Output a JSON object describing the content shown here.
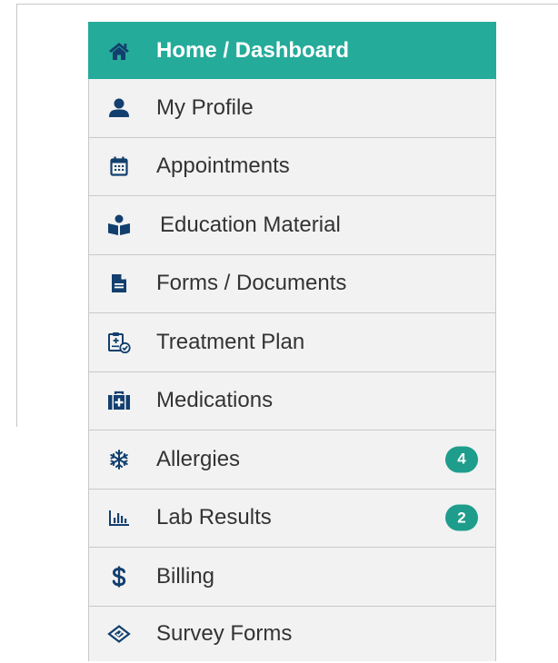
{
  "nav": {
    "items": [
      {
        "id": "home",
        "label": "Home / Dashboard",
        "icon": "home-icon",
        "active": true,
        "badge": null
      },
      {
        "id": "profile",
        "label": "My Profile",
        "icon": "user-icon",
        "active": false,
        "badge": null
      },
      {
        "id": "appointments",
        "label": "Appointments",
        "icon": "calendar-icon",
        "active": false,
        "badge": null
      },
      {
        "id": "education",
        "label": "Education Material",
        "icon": "book-reader-icon",
        "active": false,
        "badge": null
      },
      {
        "id": "forms",
        "label": "Forms / Documents",
        "icon": "document-icon",
        "active": false,
        "badge": null
      },
      {
        "id": "treatment",
        "label": "Treatment Plan",
        "icon": "clipboard-check-icon",
        "active": false,
        "badge": null
      },
      {
        "id": "medications",
        "label": "Medications",
        "icon": "medkit-icon",
        "active": false,
        "badge": null
      },
      {
        "id": "allergies",
        "label": "Allergies",
        "icon": "snowflake-icon",
        "active": false,
        "badge": "4"
      },
      {
        "id": "lab",
        "label": "Lab Results",
        "icon": "bar-chart-icon",
        "active": false,
        "badge": "2"
      },
      {
        "id": "billing",
        "label": "Billing",
        "icon": "dollar-icon",
        "active": false,
        "badge": null
      },
      {
        "id": "survey",
        "label": "Survey Forms",
        "icon": "diamond-icon",
        "active": false,
        "badge": null
      }
    ]
  },
  "colors": {
    "active_bg": "#25ab9a",
    "icon": "#123f6e",
    "badge_bg": "#1f9d8c"
  }
}
